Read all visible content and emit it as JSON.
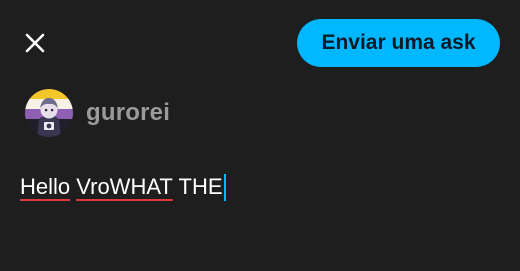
{
  "header": {
    "close_icon": "close-icon",
    "send_label": "Enviar uma ask"
  },
  "blog": {
    "name": "gurorei",
    "avatar_icon": "avatar-image"
  },
  "composer": {
    "segments": [
      {
        "text": "Hello",
        "misspelled": true
      },
      {
        "text": " ",
        "misspelled": false
      },
      {
        "text": "VroWHAT",
        "misspelled": true
      },
      {
        "text": " THE",
        "misspelled": false
      }
    ]
  },
  "colors": {
    "background": "#1e1e1e",
    "accent": "#00b8ff",
    "spellcheck_underline": "#e0383e",
    "blog_name": "#9a9a9a",
    "text": "#ffffff"
  }
}
